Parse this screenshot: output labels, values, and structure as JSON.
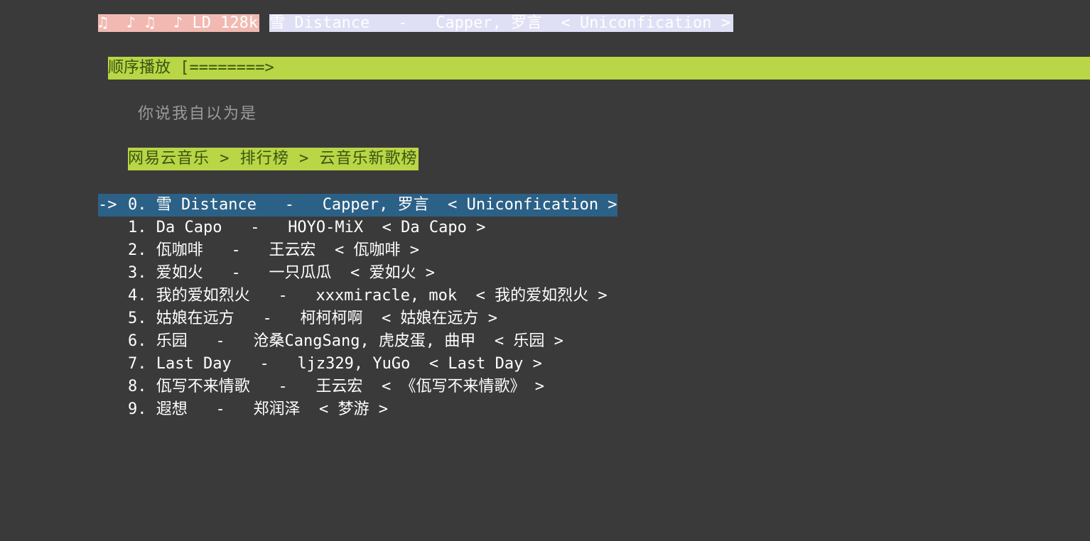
{
  "header": {
    "status_badge": "♫  ♪ ♫  ♪ LD 128k",
    "now_playing": "雪 Distance   -   Capper, 罗言  < Uniconfication >"
  },
  "player": {
    "mode_label": "顺序播放",
    "progress_text": "[========>"
  },
  "lyric": "你说我自以为是",
  "breadcrumb": "网易云音乐 > 排行榜 > 云音乐新歌榜",
  "colors": {
    "background": "#3a3a3a",
    "accent_green": "#b8d645",
    "selection_blue": "#2c6187",
    "badge_pink": "#f1b9b1",
    "now_playing_bg": "#dfdff5"
  },
  "selected_index": 0,
  "selection_arrow": "->",
  "songs": [
    {
      "idx": "0.",
      "title": "雪 Distance",
      "artist": "Capper, 罗言",
      "album": "< Uniconfication >"
    },
    {
      "idx": "1.",
      "title": "Da Capo",
      "artist": "HOYO-MiX",
      "album": "< Da Capo >"
    },
    {
      "idx": "2.",
      "title": "佤咖啡",
      "artist": "王云宏",
      "album": "< 佤咖啡 >"
    },
    {
      "idx": "3.",
      "title": "爱如火",
      "artist": "一只瓜瓜",
      "album": "< 爱如火 >"
    },
    {
      "idx": "4.",
      "title": "我的爱如烈火",
      "artist": "xxxmiracle, mok",
      "album": "< 我的爱如烈火 >"
    },
    {
      "idx": "5.",
      "title": "姑娘在远方",
      "artist": "柯柯柯啊",
      "album": "< 姑娘在远方 >"
    },
    {
      "idx": "6.",
      "title": "乐园",
      "artist": "沧桑CangSang, 虎皮蛋, 曲甲",
      "album": "< 乐园 >"
    },
    {
      "idx": "7.",
      "title": "Last Day",
      "artist": "ljz329, YuGo",
      "album": "< Last Day >"
    },
    {
      "idx": "8.",
      "title": "佤写不来情歌",
      "artist": "王云宏",
      "album": "< 《佤写不来情歌》 >"
    },
    {
      "idx": "9.",
      "title": "遐想",
      "artist": "郑润泽",
      "album": "< 梦游 >"
    }
  ]
}
